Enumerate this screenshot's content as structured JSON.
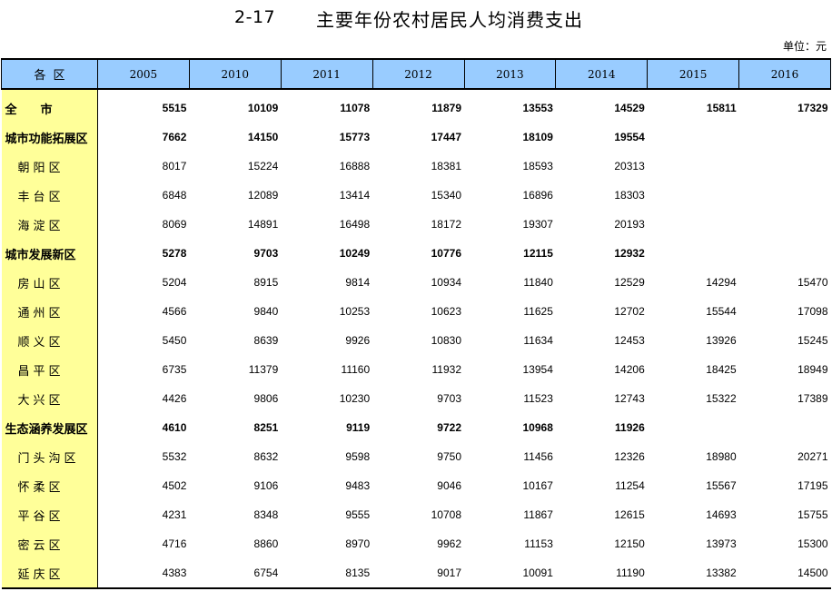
{
  "title": {
    "number": "2-17",
    "text": "主要年份农村居民人均消费支出"
  },
  "unit": "单位：元",
  "table": {
    "header_area": "各区",
    "years": [
      "2005",
      "2010",
      "2011",
      "2012",
      "2013",
      "2014",
      "2015",
      "2016"
    ],
    "rows": [
      {
        "name": "全　　市",
        "bold": true,
        "district": false,
        "values": [
          "5515",
          "10109",
          "11078",
          "11879",
          "13553",
          "14529",
          "15811",
          "17329"
        ]
      },
      {
        "name": "城市功能拓展区",
        "bold": true,
        "district": false,
        "values": [
          "7662",
          "14150",
          "15773",
          "17447",
          "18109",
          "19554",
          "",
          ""
        ]
      },
      {
        "name": "朝阳区",
        "bold": false,
        "district": true,
        "values": [
          "8017",
          "15224",
          "16888",
          "18381",
          "18593",
          "20313",
          "",
          ""
        ]
      },
      {
        "name": "丰台区",
        "bold": false,
        "district": true,
        "values": [
          "6848",
          "12089",
          "13414",
          "15340",
          "16896",
          "18303",
          "",
          ""
        ]
      },
      {
        "name": "海淀区",
        "bold": false,
        "district": true,
        "values": [
          "8069",
          "14891",
          "16498",
          "18172",
          "19307",
          "20193",
          "",
          ""
        ]
      },
      {
        "name": "城市发展新区",
        "bold": true,
        "district": false,
        "values": [
          "5278",
          "9703",
          "10249",
          "10776",
          "12115",
          "12932",
          "",
          ""
        ]
      },
      {
        "name": "房山区",
        "bold": false,
        "district": true,
        "values": [
          "5204",
          "8915",
          "9814",
          "10934",
          "11840",
          "12529",
          "14294",
          "15470"
        ]
      },
      {
        "name": "通州区",
        "bold": false,
        "district": true,
        "values": [
          "4566",
          "9840",
          "10253",
          "10623",
          "11625",
          "12702",
          "15544",
          "17098"
        ]
      },
      {
        "name": "顺义区",
        "bold": false,
        "district": true,
        "values": [
          "5450",
          "8639",
          "9926",
          "10830",
          "11634",
          "12453",
          "13926",
          "15245"
        ]
      },
      {
        "name": "昌平区",
        "bold": false,
        "district": true,
        "values": [
          "6735",
          "11379",
          "11160",
          "11932",
          "13954",
          "14206",
          "18425",
          "18949"
        ]
      },
      {
        "name": "大兴区",
        "bold": false,
        "district": true,
        "values": [
          "4426",
          "9806",
          "10230",
          "9703",
          "11523",
          "12743",
          "15322",
          "17389"
        ]
      },
      {
        "name": "生态涵养发展区",
        "bold": true,
        "district": false,
        "values": [
          "4610",
          "8251",
          "9119",
          "9722",
          "10968",
          "11926",
          "",
          ""
        ]
      },
      {
        "name": "门头沟区",
        "bold": false,
        "district": true,
        "values": [
          "5532",
          "8632",
          "9598",
          "9750",
          "11456",
          "12326",
          "18980",
          "20271"
        ]
      },
      {
        "name": "怀柔区",
        "bold": false,
        "district": true,
        "values": [
          "4502",
          "9106",
          "9483",
          "9046",
          "10167",
          "11254",
          "15567",
          "17195"
        ]
      },
      {
        "name": "平谷区",
        "bold": false,
        "district": true,
        "values": [
          "4231",
          "8348",
          "9555",
          "10708",
          "11867",
          "12615",
          "14693",
          "15755"
        ]
      },
      {
        "name": "密云区",
        "bold": false,
        "district": true,
        "values": [
          "4716",
          "8860",
          "8970",
          "9962",
          "11153",
          "12150",
          "13973",
          "15300"
        ]
      },
      {
        "name": "延庆区",
        "bold": false,
        "district": true,
        "values": [
          "4383",
          "6754",
          "8135",
          "9017",
          "10091",
          "11190",
          "13382",
          "14500"
        ]
      }
    ]
  }
}
